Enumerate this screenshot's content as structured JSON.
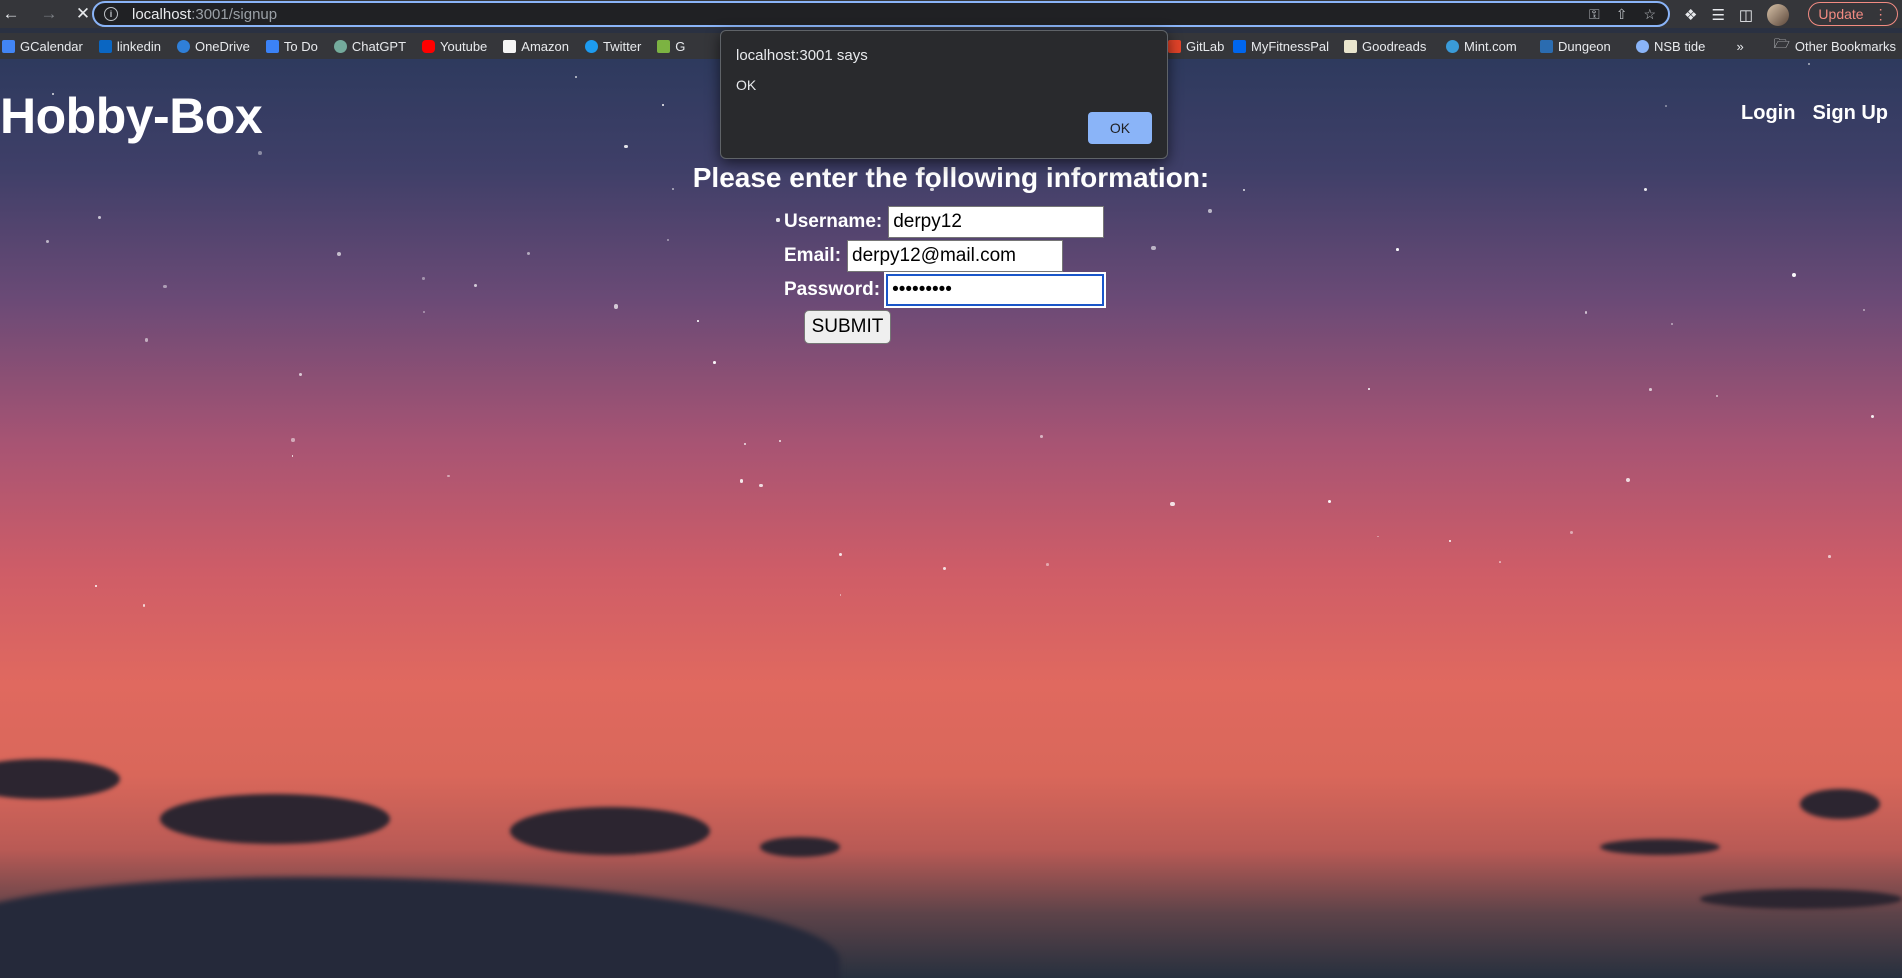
{
  "browser": {
    "url_host": "localhost",
    "url_path": ":3001/signup",
    "update_label": "Update",
    "bookmarks": [
      {
        "label": "GCalendar",
        "color": "#4285f4"
      },
      {
        "label": "linkedin",
        "color": "#0a66c2"
      },
      {
        "label": "OneDrive",
        "color": "#2f7fd8"
      },
      {
        "label": "To Do",
        "color": "#3b82f6"
      },
      {
        "label": "ChatGPT",
        "color": "#74aa9c"
      },
      {
        "label": "Youtube",
        "color": "#ff0000"
      },
      {
        "label": "Amazon",
        "color": "#f5f5f5"
      },
      {
        "label": "Twitter",
        "color": "#1d9bf0"
      },
      {
        "label": "G",
        "color": "#7cb342"
      }
    ],
    "bookmarks_right": [
      {
        "label": "GitLab",
        "color": "#e24329"
      },
      {
        "label": "MyFitnessPal",
        "color": "#0066ee"
      },
      {
        "label": "Goodreads",
        "color": "#e9e5cd"
      },
      {
        "label": "Mint.com",
        "color": "#3a9bd9"
      },
      {
        "label": "Dungeon",
        "color": "#2b6cb0"
      },
      {
        "label": "NSB tide",
        "color": "#8ab4f8"
      }
    ],
    "other_bookmarks": "Other Bookmarks",
    "overflow": "»"
  },
  "page": {
    "brand": "Hobby-Box",
    "nav": {
      "login": "Login",
      "signup": "Sign Up"
    },
    "heading": "Please enter the following information:",
    "form": {
      "username_label": "Username:",
      "username_value": "derpy12",
      "email_label": "Email:",
      "email_value": "derpy12@mail.com",
      "password_label": "Password:",
      "password_value": "•••••••••",
      "submit_label": "SUBMIT"
    }
  },
  "dialog": {
    "title": "localhost:3001 says",
    "message": "OK",
    "ok_label": "OK"
  }
}
